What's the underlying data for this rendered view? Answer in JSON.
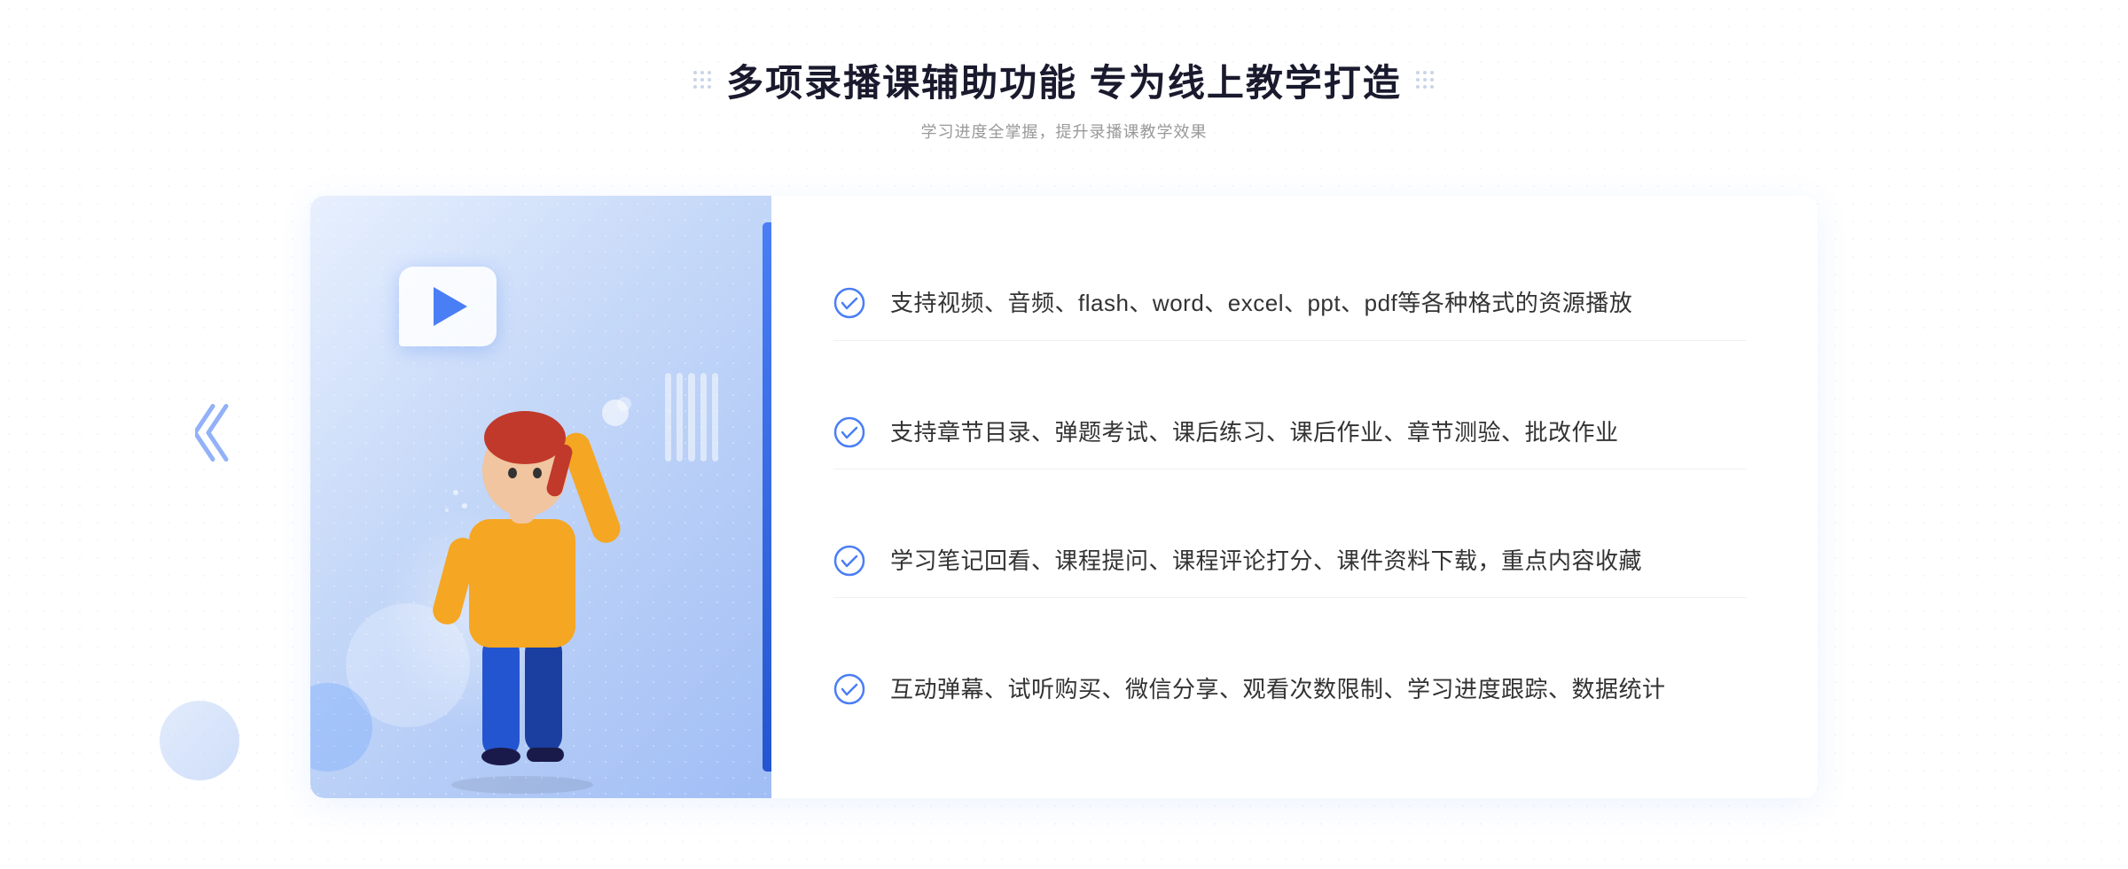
{
  "header": {
    "title": "多项录播课辅助功能 专为线上教学打造",
    "subtitle": "学习进度全掌握，提升录播课教学效果",
    "decoration_dots": "····"
  },
  "features": [
    {
      "id": 1,
      "text": "支持视频、音频、flash、word、excel、ppt、pdf等各种格式的资源播放"
    },
    {
      "id": 2,
      "text": "支持章节目录、弹题考试、课后练习、课后作业、章节测验、批改作业"
    },
    {
      "id": 3,
      "text": "学习笔记回看、课程提问、课程评论打分、课件资料下载，重点内容收藏"
    },
    {
      "id": 4,
      "text": "互动弹幕、试听购买、微信分享、观看次数限制、学习进度跟踪、数据统计"
    }
  ],
  "colors": {
    "primary_blue": "#4a7ef5",
    "dark_blue": "#2455d0",
    "light_blue_bg": "#e8f0fe",
    "text_dark": "#1a1a2e",
    "text_gray": "#999999",
    "text_body": "#333333"
  }
}
